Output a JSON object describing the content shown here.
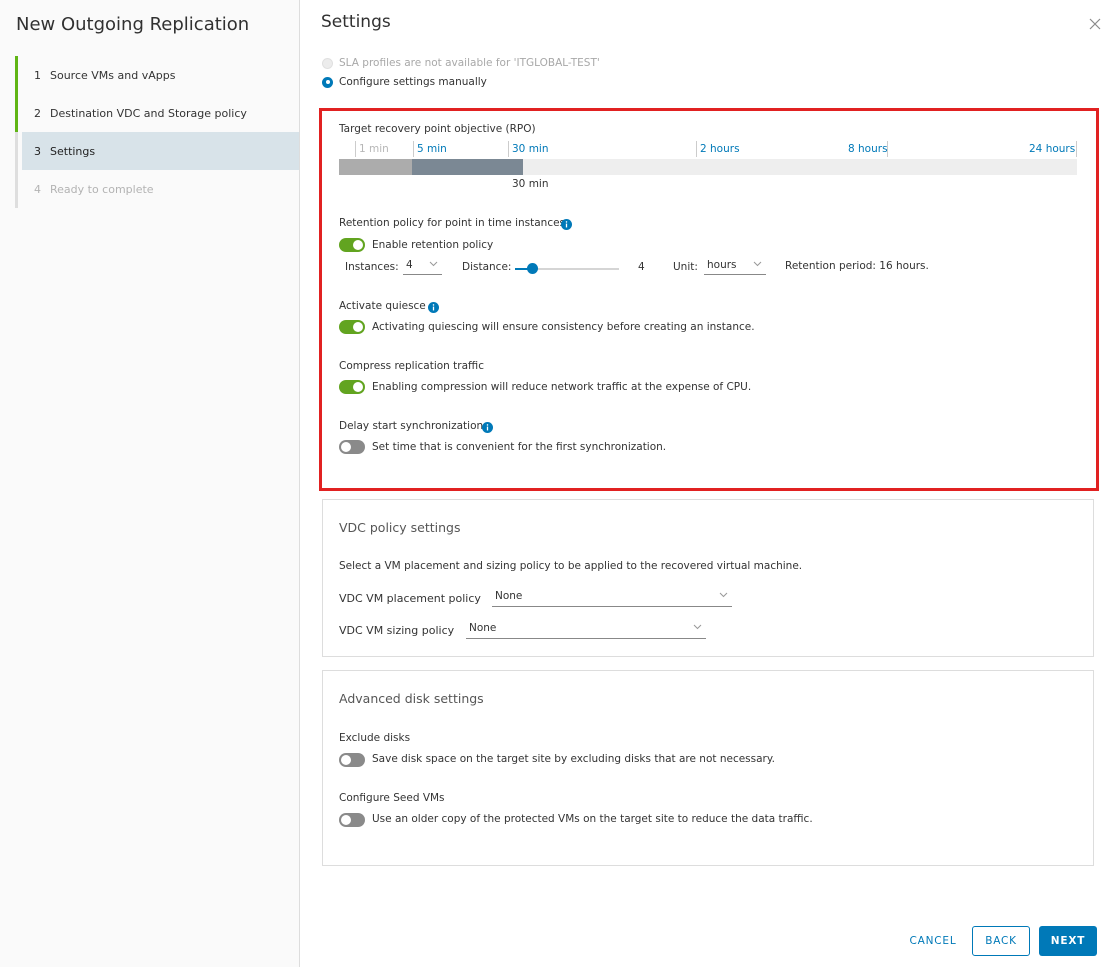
{
  "wizard": {
    "title": "New Outgoing Replication",
    "steps": [
      {
        "num": "1",
        "label": "Source VMs and vApps"
      },
      {
        "num": "2",
        "label": "Destination VDC and Storage policy"
      },
      {
        "num": "3",
        "label": "Settings"
      },
      {
        "num": "4",
        "label": "Ready to complete"
      }
    ]
  },
  "page": {
    "title": "Settings",
    "sla_option": "SLA profiles are not available for 'ITGLOBAL-TEST'",
    "manual_option": "Configure settings manually"
  },
  "rpo": {
    "label": "Target recovery point objective (RPO)",
    "ticks": [
      "1 min",
      "5 min",
      "30 min",
      "2 hours",
      "8 hours",
      "24 hours"
    ],
    "value": "30 min"
  },
  "retention": {
    "label": "Retention policy for point in time instances",
    "toggle_label": "Enable retention policy",
    "enabled": true,
    "instances_label": "Instances:",
    "instances_value": "4",
    "distance_label": "Distance:",
    "distance_value": "4",
    "unit_label": "Unit:",
    "unit_value": "hours",
    "period_text": "Retention period: 16 hours."
  },
  "quiesce": {
    "label": "Activate quiesce",
    "toggle_label": "Activating quiescing will ensure consistency before creating an instance.",
    "enabled": true
  },
  "compress": {
    "label": "Compress replication traffic",
    "toggle_label": "Enabling compression will reduce network traffic at the expense of CPU.",
    "enabled": true
  },
  "delay": {
    "label": "Delay start synchronization",
    "toggle_label": "Set time that is convenient for the first synchronization.",
    "enabled": false
  },
  "vdc_policy": {
    "title": "VDC policy settings",
    "description": "Select a VM placement and sizing policy to be applied to the recovered virtual machine.",
    "placement_label": "VDC VM placement policy",
    "placement_value": "None",
    "sizing_label": "VDC VM sizing policy",
    "sizing_value": "None"
  },
  "advanced_disk": {
    "title": "Advanced disk settings",
    "exclude_label": "Exclude disks",
    "exclude_toggle_label": "Save disk space on the target site by excluding disks that are not necessary.",
    "exclude_enabled": false,
    "seed_label": "Configure Seed VMs",
    "seed_toggle_label": "Use an older copy of the protected VMs on the target site to reduce the data traffic.",
    "seed_enabled": false
  },
  "footer": {
    "cancel": "CANCEL",
    "back": "BACK",
    "next": "NEXT"
  },
  "colors": {
    "accent": "#0079b8",
    "toggle_on": "#62a420",
    "highlight": "#e12121"
  }
}
